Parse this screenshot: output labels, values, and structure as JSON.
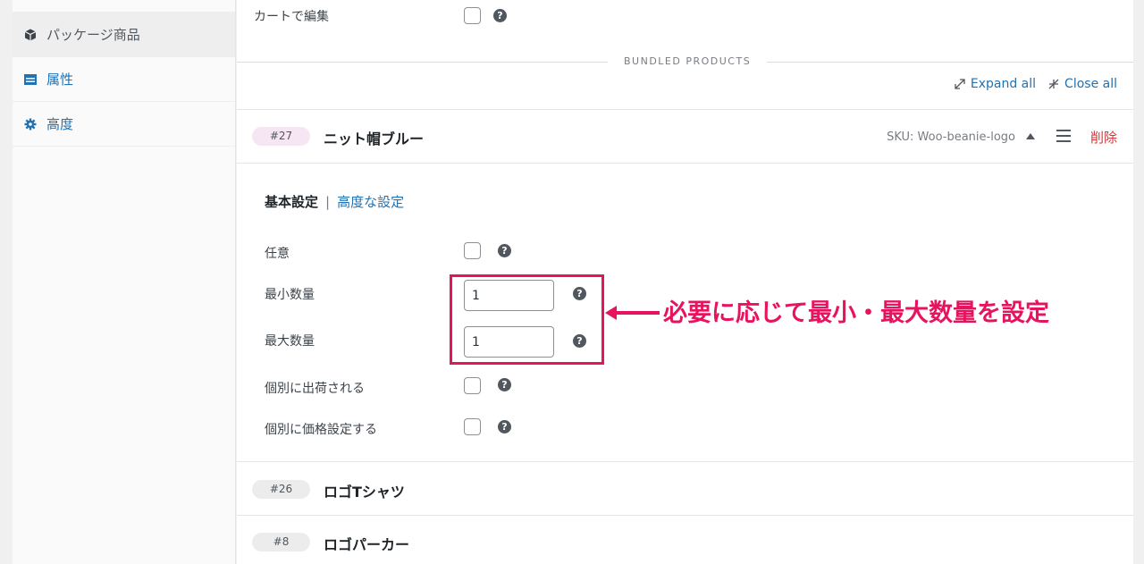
{
  "sidebar": {
    "items": [
      {
        "label": "パッケージ商品",
        "icon": "cube-icon"
      },
      {
        "label": "属性",
        "icon": "list-icon"
      },
      {
        "label": "高度",
        "icon": "gear-icon"
      }
    ]
  },
  "top_field": {
    "label": "カートで編集"
  },
  "bundled": {
    "heading": "BUNDLED PRODUCTS",
    "expand_all": "Expand all",
    "close_all": "Close all"
  },
  "items": [
    {
      "id": "#27",
      "title": "ニット帽ブルー",
      "sku": "SKU: Woo-beanie-logo",
      "delete": "削除"
    },
    {
      "id": "#26",
      "title": "ロゴTシャツ"
    },
    {
      "id": "#8",
      "title": "ロゴパーカー"
    }
  ],
  "settings": {
    "tab_basic": "基本設定",
    "separator": "|",
    "tab_advanced": "高度な設定",
    "optional_label": "任意",
    "min_qty_label": "最小数量",
    "min_qty_value": "1",
    "max_qty_label": "最大数量",
    "max_qty_value": "1",
    "ship_individually_label": "個別に出荷される",
    "price_individually_label": "個別に価格設定する"
  },
  "help_glyph": "?",
  "annotation": {
    "text": "必要に応じて最小・最大数量を設定",
    "color": "#e8135e"
  },
  "colors": {
    "link": "#2271b1",
    "delete": "#d63638",
    "accent": "#e8135e"
  }
}
